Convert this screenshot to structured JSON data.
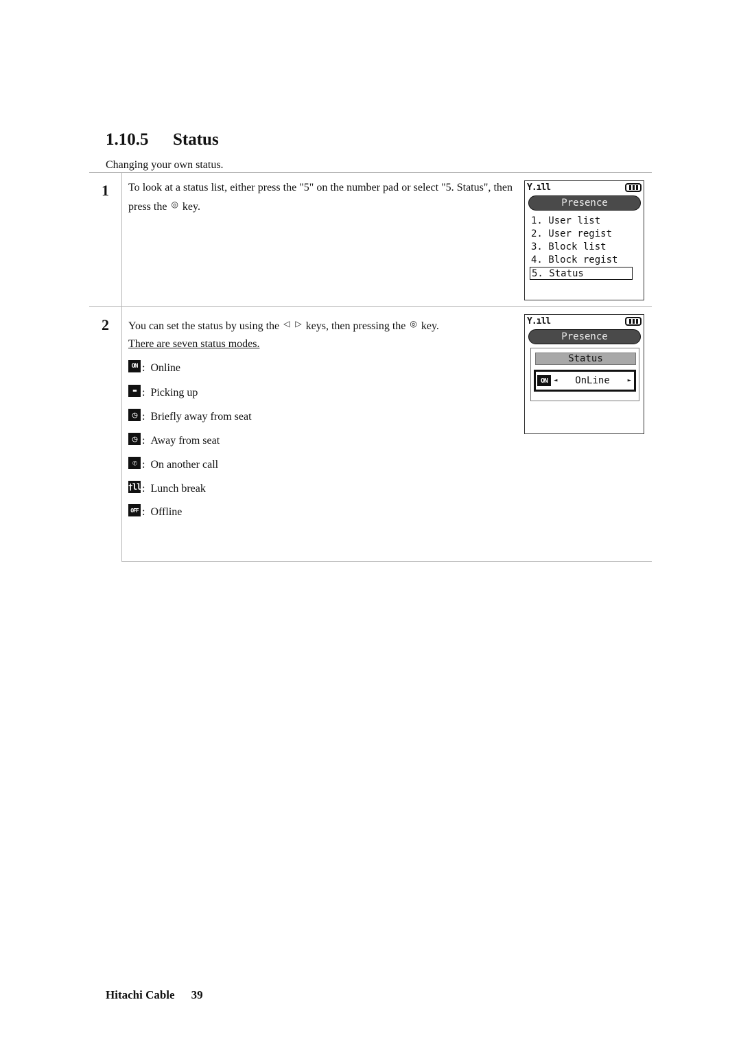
{
  "section": {
    "number": "1.10.5",
    "title": "Status",
    "intro": "Changing your own status."
  },
  "steps": [
    {
      "number": "1",
      "text_before_key": "To look at a status list, either press the \"5\" on the number pad or select \"5. Status\", then press the",
      "text_after_key": "key.",
      "key_icon": "◎"
    },
    {
      "number": "2",
      "text_before_keys": "You can set the status by using the",
      "left_key_icon": "◁",
      "right_key_icon": "▷",
      "text_middle": "keys, then pressing the",
      "select_key_icon": "◎",
      "text_after": "key.",
      "note": "There are seven status modes.",
      "modes": [
        {
          "icon": "ON",
          "icon_name": "online-icon",
          "label": "Online"
        },
        {
          "icon": "▬",
          "icon_name": "picking-up-icon",
          "label": "Picking up"
        },
        {
          "icon": "◷",
          "icon_name": "clock-icon",
          "label": "Briefly away from seat"
        },
        {
          "icon": "◷",
          "icon_name": "clock-icon",
          "label": "Away from seat"
        },
        {
          "icon": "✆",
          "icon_name": "phone-icon",
          "label": "On another call"
        },
        {
          "icon": "🍴",
          "icon_name": "fork-knife-icon",
          "label": "Lunch break"
        },
        {
          "icon": "OFF",
          "icon_name": "offline-icon",
          "label": "Offline"
        }
      ]
    }
  ],
  "screens": [
    {
      "signal": "Y.ıll",
      "title": "Presence",
      "menu": [
        "1. User list",
        "2. User regist",
        "3. Block list",
        "4. Block regist",
        "5. Status"
      ],
      "selected_index": 4
    },
    {
      "signal": "Y.ıll",
      "title": "Presence",
      "panel_title": "Status",
      "status_icon": "ON",
      "left_arrow": "◄",
      "status_value": "OnLine",
      "right_arrow": "►"
    }
  ],
  "footer": {
    "brand": "Hitachi Cable",
    "page": "39"
  }
}
